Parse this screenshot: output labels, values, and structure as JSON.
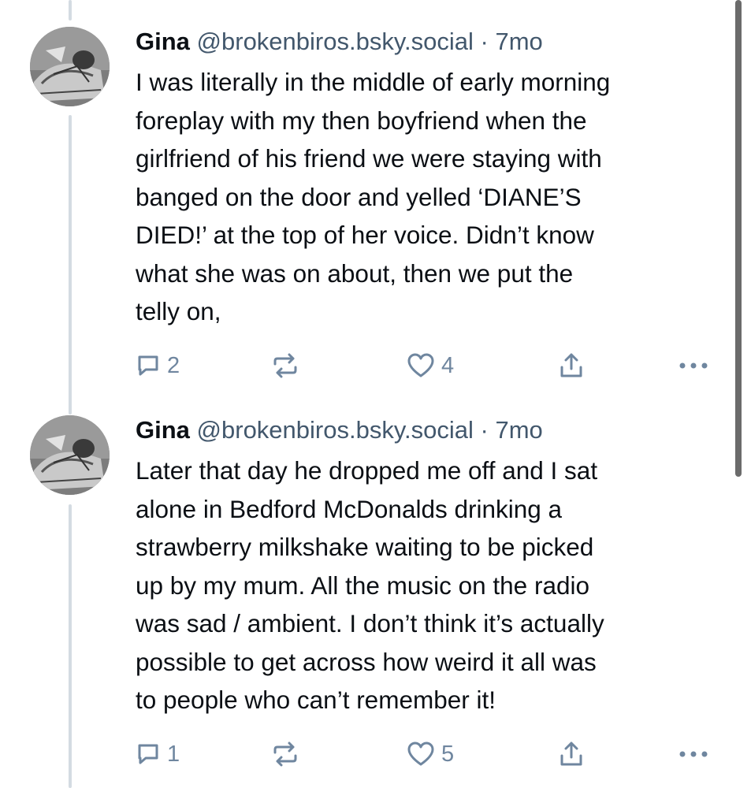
{
  "theme": {
    "thread_line_color": "#d4dbe2",
    "text_color": "#0b0f14",
    "meta_color": "#42576c",
    "icon_color": "#6f869f"
  },
  "posts": [
    {
      "author_name": "Gina",
      "handle": "@brokenbiros.bsky.social",
      "separator": "·",
      "time": "7mo",
      "text": "I was literally in the middle of early morning\nforeplay with my then boyfriend when the\ngirlfriend of his friend we were staying with\nbanged on the door and yelled ‘DIANE’S\nDIED!’ at the top of her voice. Didn’t know\nwhat she was on about, then we put the\ntelly on,",
      "reply_count": "2",
      "repost_count": "",
      "like_count": "4",
      "icons": {
        "reply": "speech-bubble-icon",
        "repost": "repost-arrows-icon",
        "like": "heart-icon",
        "share": "share-upload-icon",
        "more": "more-dots-icon"
      }
    },
    {
      "author_name": "Gina",
      "handle": "@brokenbiros.bsky.social",
      "separator": "·",
      "time": "7mo",
      "text": "Later that day he dropped me off and I sat\nalone in Bedford McDonalds drinking a\nstrawberry milkshake waiting to be picked\nup by my mum. All the music on the radio\nwas sad / ambient. I don’t think it’s actually\npossible to get across how weird it all was\nto people who can’t remember it!",
      "reply_count": "1",
      "repost_count": "",
      "like_count": "5",
      "icons": {
        "reply": "speech-bubble-icon",
        "repost": "repost-arrows-icon",
        "like": "heart-icon",
        "share": "share-upload-icon",
        "more": "more-dots-icon"
      }
    }
  ]
}
